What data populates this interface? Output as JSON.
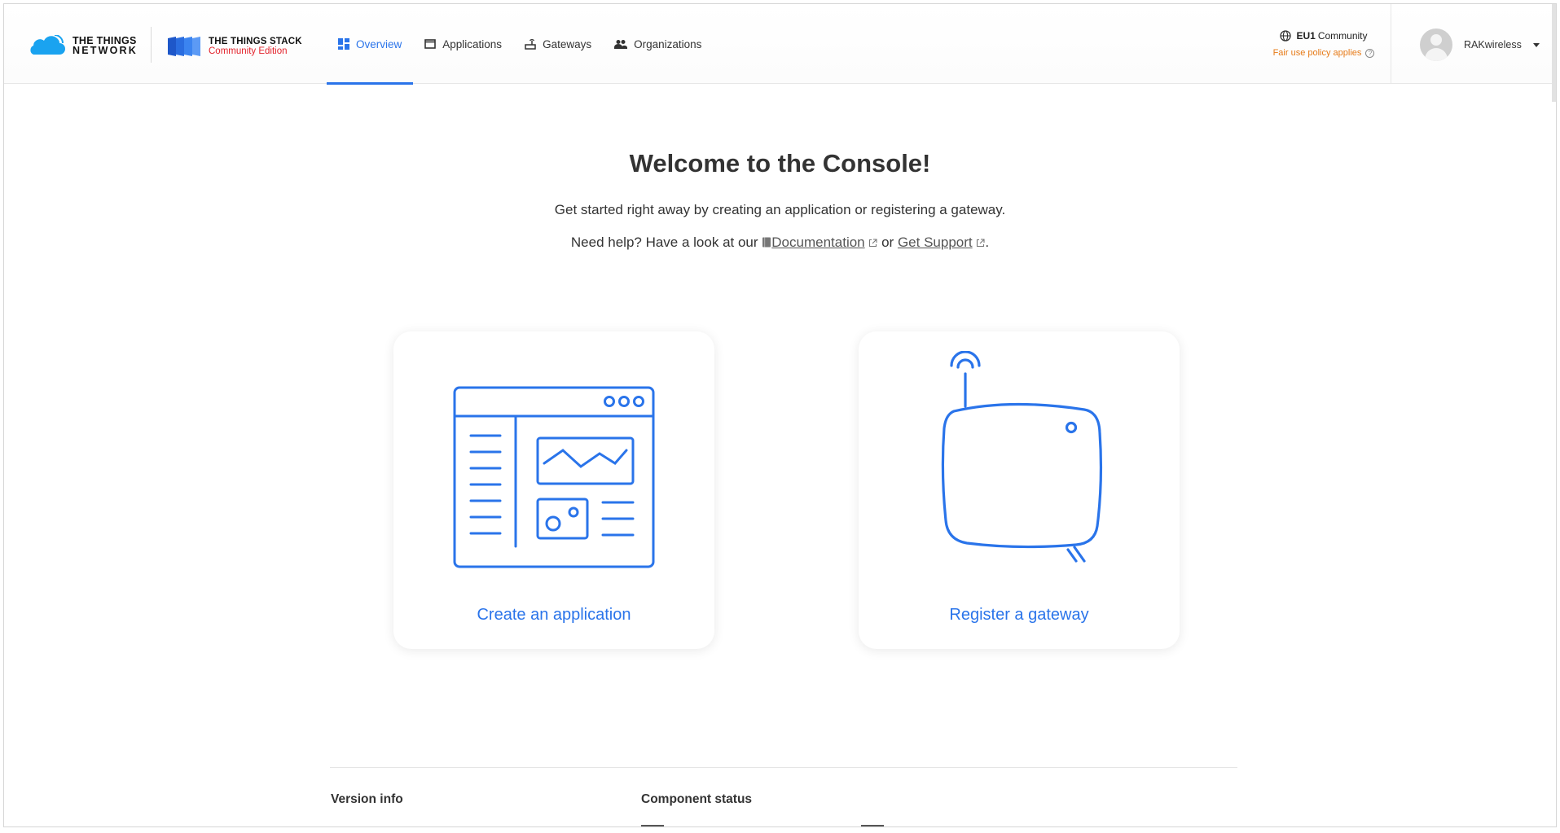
{
  "header": {
    "ttn_logo": {
      "line1": "THE THINGS",
      "line2": "NETWORK"
    },
    "tts_logo": {
      "line1": "THE THINGS STACK",
      "line2": "Community Edition"
    },
    "nav": [
      {
        "label": "Overview",
        "icon": "dashboard-icon",
        "active": true
      },
      {
        "label": "Applications",
        "icon": "application-window-icon",
        "active": false
      },
      {
        "label": "Gateways",
        "icon": "router-icon",
        "active": false
      },
      {
        "label": "Organizations",
        "icon": "people-icon",
        "active": false
      }
    ],
    "region": {
      "code": "EU1",
      "name": "Community",
      "policy": "Fair use policy applies"
    },
    "user": {
      "name": "RAKwireless"
    }
  },
  "main": {
    "title": "Welcome to the Console!",
    "subtitle": "Get started right away by creating an application or registering a gateway.",
    "help": {
      "prefix": "Need help? Have a look at our",
      "doc_link": "Documentation",
      "or": "or",
      "support_link": "Get Support",
      "suffix": "."
    },
    "cards": [
      {
        "label": "Create an application",
        "icon": "application-illustration"
      },
      {
        "label": "Register a gateway",
        "icon": "gateway-illustration"
      }
    ]
  },
  "footer": {
    "version_heading": "Version info",
    "status_heading": "Component status"
  },
  "colors": {
    "accent": "#2a74ea",
    "warning": "#e67a17",
    "brand_red": "#e3222b"
  }
}
